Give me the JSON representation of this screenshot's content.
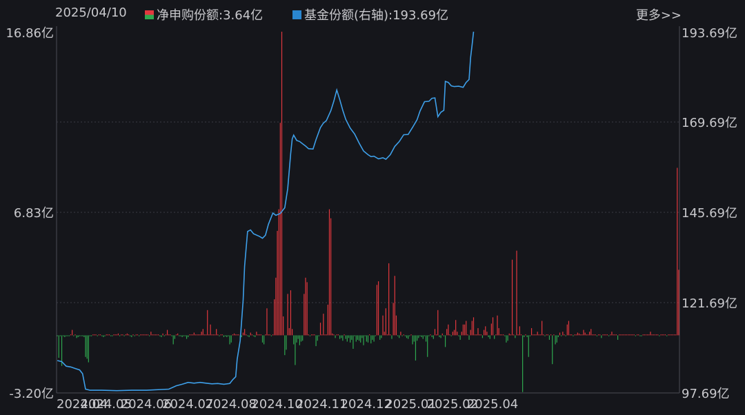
{
  "header": {
    "date": "2025/04/10",
    "more_label": "更多>>"
  },
  "legend": [
    {
      "label": "净申购份额:3.64亿",
      "colors": [
        "#e2383e",
        "#2fa84f"
      ]
    },
    {
      "label": "基金份额(右轴):193.69亿",
      "colors": [
        "#2a86d0"
      ]
    }
  ],
  "colors": {
    "background": "#15161b",
    "inflow": "#e2383e",
    "outflow": "#2fa84f",
    "share_line": "#3ea0ea",
    "grid": "#3a3c44"
  },
  "chart_data": {
    "type": "bar",
    "left_axis": {
      "unit": "亿",
      "range": [
        -3.2,
        16.86
      ],
      "ticks": [
        16.86,
        6.83,
        -3.2
      ],
      "tick_labels": [
        "16.86亿",
        "6.83亿",
        "-3.20亿"
      ]
    },
    "right_axis": {
      "unit": "亿",
      "range": [
        97.69,
        193.69
      ],
      "ticks": [
        193.69,
        169.69,
        145.69,
        121.69,
        97.69
      ],
      "tick_labels": [
        "193.69亿",
        "169.69亿",
        "145.69亿",
        "121.69亿",
        "97.69亿"
      ]
    },
    "x_tick_labels": [
      "2024.04",
      "2024.05",
      "2024.06",
      "2024.07",
      "2024.08",
      "2024.10",
      "2024.11",
      "2024.12",
      "2025.01",
      "2025.02",
      "2025.04"
    ],
    "x_tick_positions": [
      0,
      16,
      43,
      71,
      100,
      131,
      161,
      191,
      221,
      249,
      276
    ],
    "series": [
      {
        "name": "净申购份额",
        "axis": "left",
        "values": [
          -0.05,
          -1.25,
          -0.05,
          -1.7,
          -0.05,
          -0.1,
          -0.05,
          -0.05,
          -0.05,
          0.05,
          0.3,
          -0.05,
          0.05,
          -0.15,
          -0.1,
          -0.05,
          -0.05,
          -0.05,
          -0.1,
          -1.2,
          -1.3,
          -1.5,
          -0.05,
          -0.05,
          0.05,
          0.05,
          0.05,
          -0.05,
          0.05,
          0.05,
          -0.05,
          -0.1,
          -0.05,
          0.05,
          0.05,
          0.05,
          -0.05,
          -0.05,
          0.05,
          0.05,
          0.05,
          0.1,
          -0.05,
          0.05,
          0.05,
          -0.05,
          0.05,
          0.1,
          0.05,
          -0.05,
          -0.1,
          0.05,
          -0.05,
          0.05,
          0.05,
          -0.05,
          0.05,
          0.05,
          0.05,
          0.05,
          0.05,
          0.05,
          -0.05,
          0.2,
          0.05,
          0.05,
          0.05,
          0.05,
          0.05,
          -0.05,
          -0.1,
          0.1,
          -0.05,
          0.05,
          0.3,
          0.05,
          0.05,
          -0.05,
          -0.5,
          -0.2,
          0.05,
          0.1,
          -0.05,
          -0.05,
          -0.1,
          -0.05,
          -0.05,
          -0.2,
          -0.1,
          0.05,
          0.05,
          0.05,
          0.15,
          0.05,
          0.05,
          0.05,
          0.05,
          0.2,
          0.35,
          0.05,
          0.05,
          1.4,
          0.05,
          0.6,
          0.05,
          0.05,
          0.05,
          0.35,
          0.05,
          -0.05,
          0.05,
          0.05,
          -0.1,
          -0.05,
          -0.1,
          -0.05,
          -0.5,
          -0.4,
          0.05,
          0.1,
          0.05,
          0.05,
          0.05,
          -0.2,
          -0.1,
          0.15,
          0.35,
          0.05,
          -0.05,
          -0.1,
          0.15,
          0.05,
          -0.05,
          -0.1,
          0.2,
          0.05,
          0.05,
          0.05,
          -0.4,
          -0.5,
          0.05,
          1.5,
          0.05,
          0.05,
          -0.05,
          0.05,
          2.0,
          3.2,
          5.8,
          7.0,
          11.8,
          16.86,
          1.05,
          -1.1,
          -0.8,
          2.3,
          0.4,
          2.5,
          0.35,
          -0.5,
          -1.65,
          -0.4,
          -0.2,
          -0.55,
          -0.35,
          -0.3,
          2.3,
          3.2,
          2.95,
          0.05,
          -0.05,
          0.05,
          0.05,
          0.05,
          -0.6,
          -0.3,
          -0.05,
          0.7,
          0.05,
          1.2,
          0.05,
          0.05,
          1.7,
          7.0,
          6.5,
          0.1,
          0.05,
          -0.15,
          0.05,
          0.05,
          -0.2,
          -0.15,
          -0.3,
          0.05,
          -0.2,
          -0.35,
          -0.15,
          -0.4,
          -0.25,
          -0.75,
          -0.05,
          -0.35,
          -0.25,
          -0.3,
          -0.4,
          -0.15,
          -0.55,
          -0.05,
          -0.35,
          -0.4,
          0.05,
          -0.45,
          -0.25,
          -0.35,
          -0.05,
          2.8,
          3.0,
          -0.25,
          -0.15,
          1.1,
          0.2,
          1.5,
          0.05,
          4.0,
          0.05,
          -0.2,
          1.8,
          3.3,
          1.1,
          -0.05,
          -0.15,
          0.2,
          -0.05,
          0.05,
          -0.05,
          -0.15,
          -0.2,
          -0.05,
          0.05,
          -0.5,
          -0.35,
          -1.4,
          -0.3,
          -0.15,
          -0.05,
          -0.1,
          -0.2,
          -0.05,
          -0.35,
          -1.2,
          -0.05,
          0.05,
          -0.1,
          -0.2,
          0.35,
          0.05,
          1.4,
          -0.1,
          -0.15,
          0.1,
          -0.05,
          -0.65,
          0.35,
          0.6,
          0.05,
          -0.05,
          0.2,
          0.3,
          0.85,
          0.2,
          -0.05,
          -0.25,
          0.2,
          0.6,
          0.6,
          0.8,
          0.05,
          -0.25,
          0.3,
          0.8,
          1.0,
          0.05,
          0.05,
          0.4,
          0.05,
          0.05,
          -0.15,
          0.3,
          0.5,
          0.2,
          -0.1,
          -0.2,
          0.65,
          1.0,
          -0.2,
          0.05,
          1.1,
          0.4,
          0.05,
          0.05,
          0.05,
          -0.05,
          -0.4,
          -0.3,
          0.1,
          0.05,
          4.2,
          0.05,
          -0.15,
          4.7,
          0.05,
          0.5,
          0.05,
          -3.15,
          -0.1,
          0.05,
          -0.1,
          -1.2,
          -0.05,
          0.4,
          0.05,
          0.05,
          0.05,
          0.2,
          0.05,
          0.05,
          0.8,
          0.05,
          -0.05,
          0.05,
          0.05,
          -0.25,
          0.05,
          -1.6,
          0.05,
          -0.5,
          -0.4,
          -0.1,
          0.15,
          -0.05,
          0.2,
          0.05,
          -0.05,
          0.6,
          0.8,
          0.05,
          0.05,
          -0.05,
          0.05,
          0.05,
          0.15,
          0.1,
          0.05,
          0.05,
          0.3,
          0.15,
          0.05,
          0.05,
          0.2,
          0.35,
          0.05,
          0.05,
          0.05,
          -0.05,
          0.05,
          0.05,
          -0.15,
          0.05,
          0.05,
          0.05,
          0.05,
          -0.05,
          0.05,
          0.2,
          0.05,
          0.05,
          0.05,
          -0.25,
          0.05,
          0.05,
          0.05,
          0.05,
          0.05,
          0.05,
          0.05,
          0.05,
          0.05,
          0.05,
          0.05,
          -0.05,
          0.05,
          0.05,
          -0.05,
          -0.05,
          0.05,
          0.05,
          0.05,
          0.05,
          0.05,
          0.2,
          0.05,
          0.05,
          0.05,
          0.05,
          0.05,
          -0.05,
          0.05,
          0.05,
          0.05,
          0.05,
          -0.05,
          0.05,
          0.05,
          0.05,
          0.05,
          0.05,
          0.05,
          9.3,
          3.64
        ]
      },
      {
        "name": "基金份额",
        "axis": "right",
        "points": [
          [
            0,
            106.3
          ],
          [
            3,
            106.0
          ],
          [
            6,
            104.8
          ],
          [
            9,
            104.6
          ],
          [
            12,
            104.2
          ],
          [
            15,
            103.8
          ],
          [
            17,
            102.8
          ],
          [
            19,
            98.7
          ],
          [
            22,
            98.4
          ],
          [
            30,
            98.4
          ],
          [
            40,
            98.3
          ],
          [
            50,
            98.4
          ],
          [
            60,
            98.4
          ],
          [
            70,
            98.6
          ],
          [
            75,
            98.7
          ],
          [
            80,
            99.6
          ],
          [
            84,
            100.0
          ],
          [
            88,
            100.5
          ],
          [
            92,
            100.3
          ],
          [
            96,
            100.5
          ],
          [
            100,
            100.3
          ],
          [
            104,
            100.1
          ],
          [
            108,
            100.2
          ],
          [
            112,
            100.0
          ],
          [
            116,
            100.2
          ],
          [
            118,
            101.2
          ],
          [
            120,
            102.0
          ],
          [
            121,
            106.6
          ],
          [
            123,
            111.6
          ],
          [
            125,
            122.4
          ],
          [
            126,
            131.4
          ],
          [
            128,
            140.6
          ],
          [
            130,
            141.0
          ],
          [
            132,
            140.0
          ],
          [
            136,
            139.3
          ],
          [
            138,
            138.8
          ],
          [
            140,
            139.6
          ],
          [
            142,
            142.5
          ],
          [
            145,
            145.5
          ],
          [
            147,
            144.9
          ],
          [
            150,
            145.4
          ],
          [
            153,
            146.9
          ],
          [
            155,
            152.0
          ],
          [
            157,
            161.3
          ],
          [
            158,
            165.2
          ],
          [
            159,
            166.2
          ],
          [
            161,
            164.8
          ],
          [
            163,
            164.5
          ],
          [
            165,
            163.9
          ],
          [
            167,
            163.3
          ],
          [
            169,
            162.6
          ],
          [
            172,
            162.5
          ],
          [
            174,
            165.0
          ],
          [
            177,
            168.2
          ],
          [
            179,
            169.4
          ],
          [
            181,
            170.1
          ],
          [
            184,
            172.7
          ],
          [
            186,
            175.2
          ],
          [
            188,
            178.2
          ],
          [
            190,
            175.6
          ],
          [
            192,
            172.8
          ],
          [
            194,
            170.4
          ],
          [
            197,
            168.1
          ],
          [
            200,
            166.5
          ],
          [
            203,
            164.1
          ],
          [
            206,
            162.0
          ],
          [
            209,
            161.0
          ],
          [
            211,
            160.5
          ],
          [
            213,
            160.6
          ],
          [
            216,
            159.9
          ],
          [
            219,
            160.2
          ],
          [
            221,
            159.8
          ],
          [
            224,
            161.0
          ],
          [
            227,
            163.2
          ],
          [
            230,
            164.5
          ],
          [
            233,
            166.3
          ],
          [
            236,
            166.4
          ],
          [
            239,
            168.3
          ],
          [
            242,
            170.3
          ],
          [
            244,
            172.6
          ],
          [
            247,
            175.1
          ],
          [
            250,
            175.2
          ],
          [
            252,
            176.0
          ],
          [
            254,
            176.1
          ],
          [
            256,
            171.1
          ],
          [
            258,
            172.3
          ],
          [
            260,
            172.8
          ],
          [
            261,
            180.5
          ],
          [
            263,
            180.2
          ],
          [
            265,
            179.3
          ],
          [
            267,
            179.1
          ],
          [
            270,
            179.2
          ],
          [
            273,
            178.9
          ],
          [
            275,
            180.2
          ],
          [
            277,
            181.0
          ],
          [
            278,
            186.8
          ],
          [
            279,
            190.2
          ],
          [
            280,
            193.69
          ]
        ]
      }
    ]
  }
}
